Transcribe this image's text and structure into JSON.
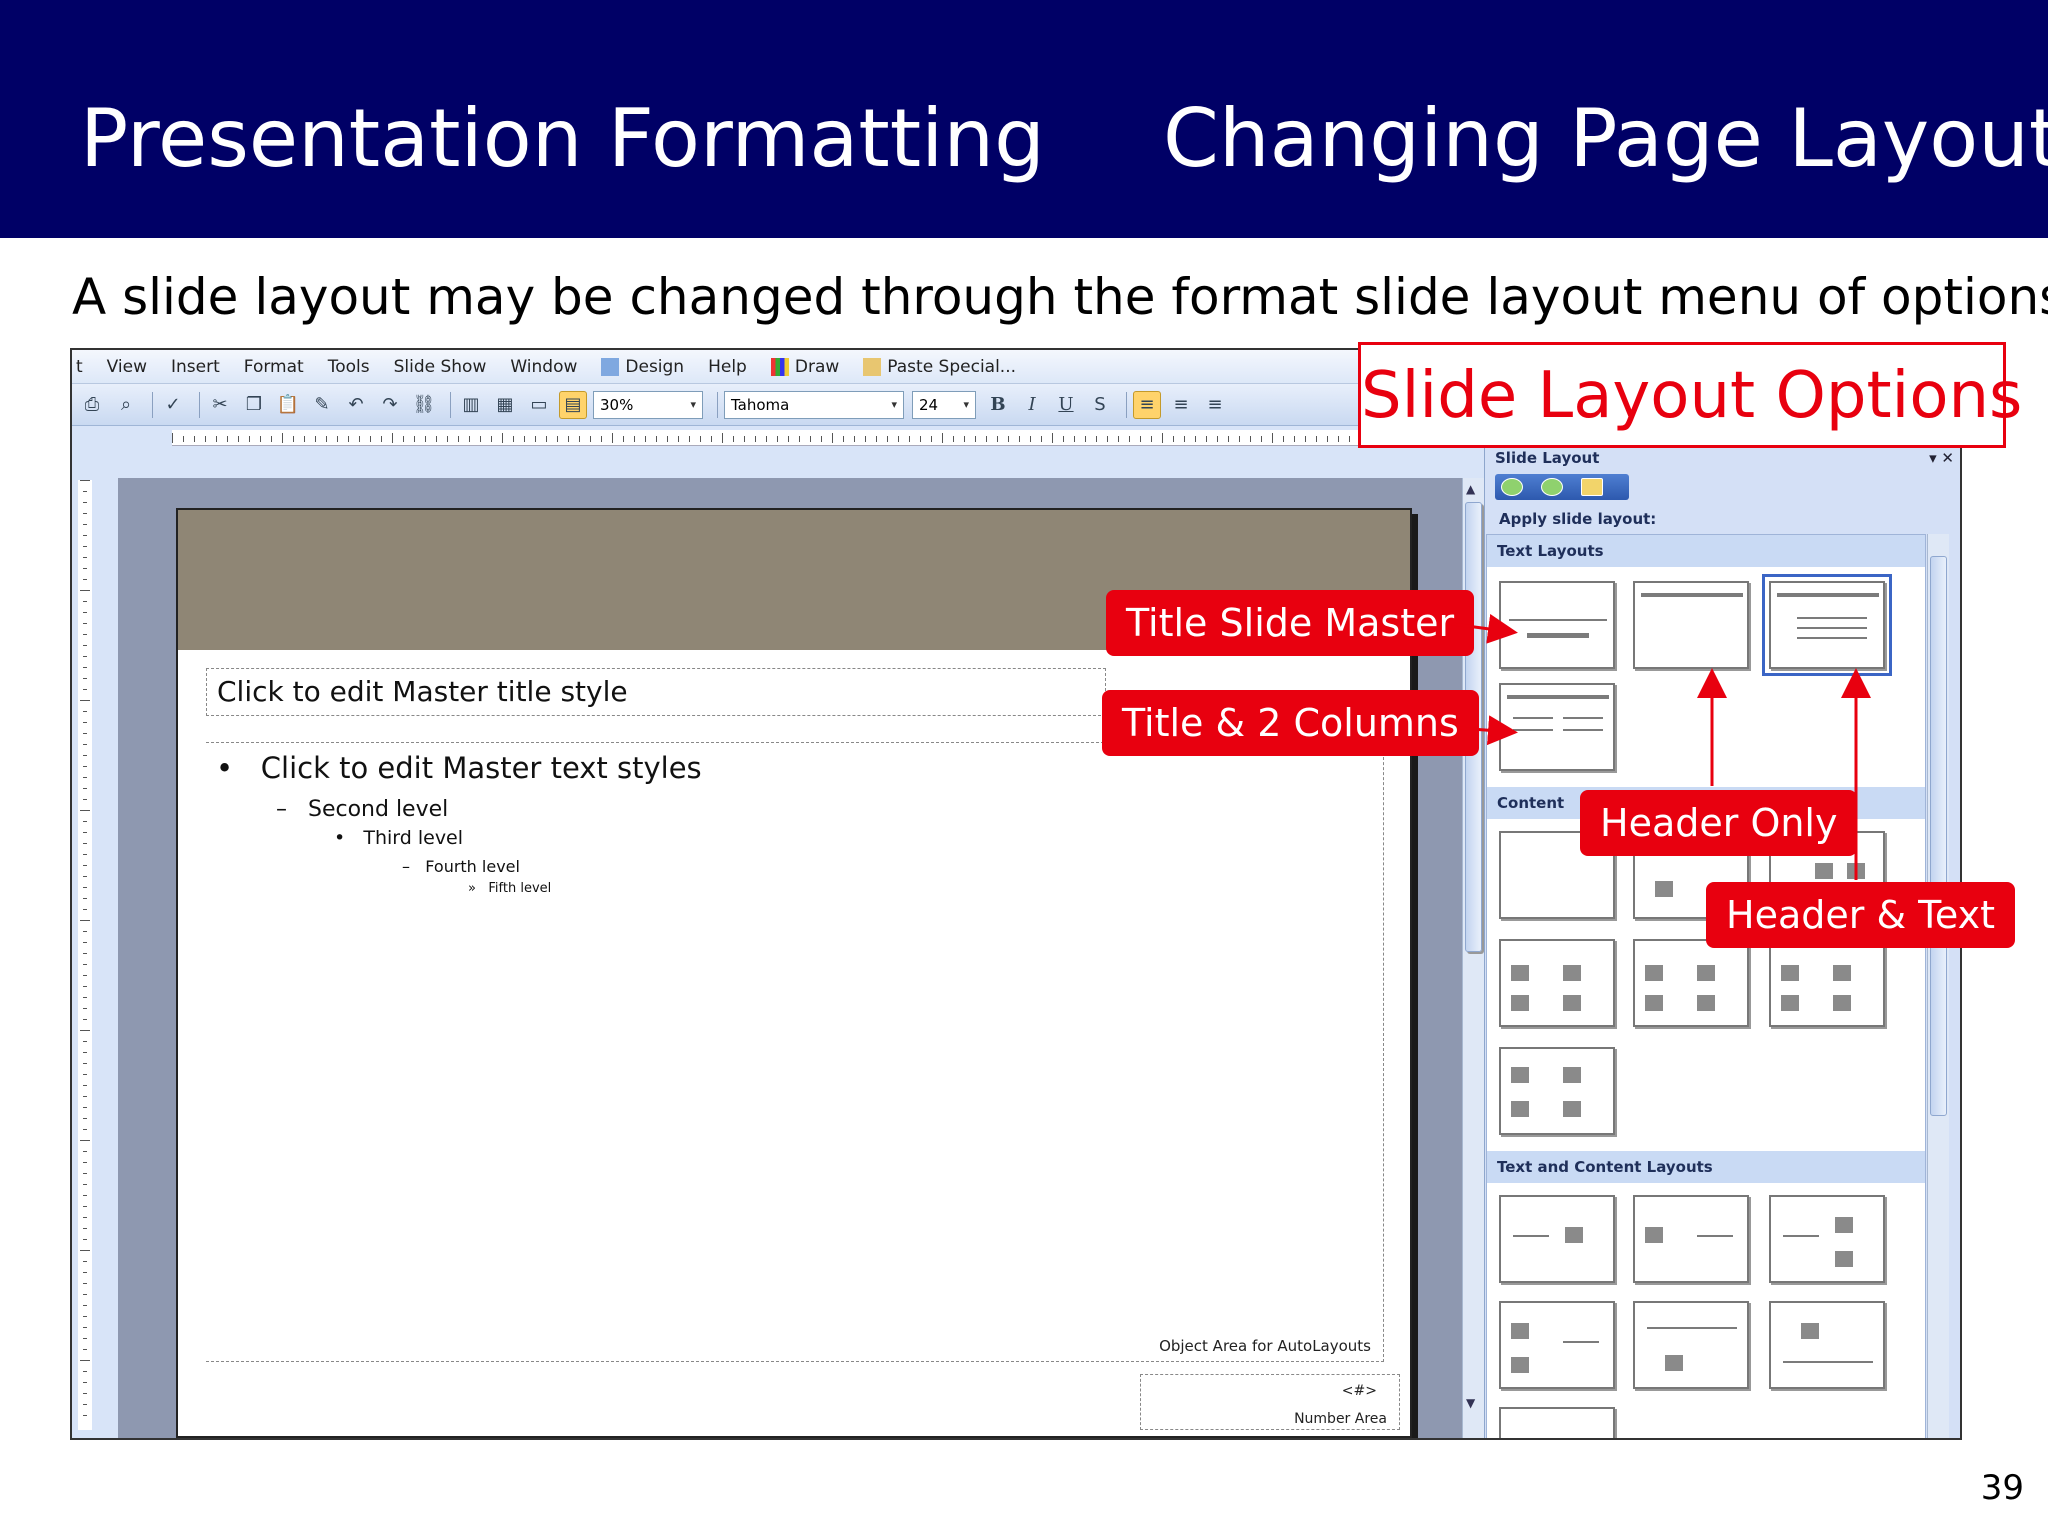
{
  "header": {
    "title_left": "Presentation Formatting",
    "title_right": "Changing Page Layout",
    "background": "#000066"
  },
  "intro": "A slide layout may be changed through the format slide layout menu of options.",
  "page_number": "39",
  "options_label": "Slide Layout Options",
  "callouts": {
    "title_slide_master": "Title Slide Master",
    "title_2_columns": "Title & 2 Columns",
    "header_only": "Header Only",
    "header_text": "Header & Text",
    "color": "#e8000f"
  },
  "app": {
    "menu": [
      "t",
      "View",
      "Insert",
      "Format",
      "Tools",
      "Slide Show",
      "Window",
      "Design",
      "Help",
      "Draw",
      "Paste Special..."
    ],
    "toolbar": {
      "zoom": "30%",
      "font": "Tahoma",
      "size": "24",
      "bold": "B",
      "italic": "I",
      "underline": "U",
      "shadow": "S"
    },
    "slide": {
      "title_placeholder": "Click to edit Master title style",
      "levels": [
        "Click to edit Master text styles",
        "Second level",
        "Third level",
        "Fourth level",
        "Fifth level"
      ],
      "bullets": [
        "•",
        "–",
        "•",
        "–",
        "»"
      ],
      "object_area": "Object Area for AutoLayouts",
      "number_symbol": "<#>",
      "number_area": "Number Area"
    },
    "task_pane": {
      "title": "Slide Layout",
      "close": "▾ ✕",
      "apply_label": "Apply slide layout:",
      "sections": [
        "Text Layouts",
        "Content Layouts",
        "Text and Content Layouts"
      ],
      "content_short": "Content"
    }
  }
}
